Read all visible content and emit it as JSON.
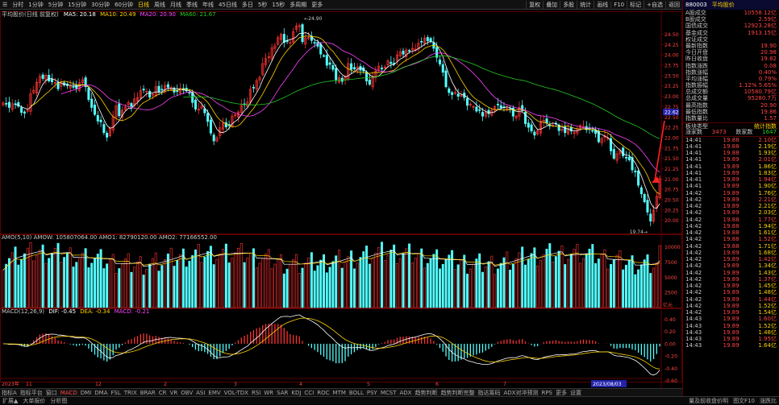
{
  "toolbar": {
    "items": [
      "分时",
      "1分钟",
      "5分钟",
      "15分钟",
      "30分钟",
      "60分钟",
      "日线",
      "周线",
      "月线",
      "季线",
      "年线",
      "45日线",
      "多日",
      "5秒",
      "15秒",
      "多周期",
      "更多"
    ],
    "right": [
      "复权",
      "叠加",
      "多股",
      "统计",
      "画线",
      "F10",
      "标记",
      "+自选",
      "返回"
    ]
  },
  "main_caption": {
    "name": "平均股价(日线 前复权)",
    "ma5": "MA5: 20.18",
    "ma10": "MA10: 20.49",
    "ma20": "MA20: 20.90",
    "ma60": "MA60: 21.67"
  },
  "price_axis": [
    "24.50",
    "24.25",
    "24.00",
    "23.75",
    "23.50",
    "23.25",
    "23.00",
    "22.75",
    "22.50",
    "22.25",
    "22.00",
    "21.75",
    "21.50",
    "21.25",
    "21.00",
    "20.75",
    "20.50",
    "20.25",
    "20.00"
  ],
  "current_price_tag": "22.62",
  "high_label": "24.90",
  "low_label": "19.74",
  "amo_caption": "AMO(5,10)  AMOW: 105807064.00  AMO1: 82790120.00  AMO2: 77166552.00",
  "amo_axis": [
    "10000",
    "7500",
    "5000",
    "2500"
  ],
  "amo_unit": "亿元",
  "macd_caption": {
    "name": "MACD(12,26,9)",
    "dif": "DIF: -0.45",
    "dea": "DEA: -0.34",
    "macd": "MACD: -0.21"
  },
  "macd_axis": [
    "0.40",
    "0.20",
    "0.00",
    "-0.20",
    "-0.40",
    "-0.60"
  ],
  "date_axis": {
    "start": "2023年",
    "labels": [
      "11",
      "12",
      "2",
      "3",
      "4",
      "5",
      "6",
      "7"
    ],
    "cursor_date": "2023/08/03"
  },
  "right_panel": {
    "code": "880003",
    "name": "平均股价",
    "stats": [
      {
        "k": "A股成交",
        "v": "10558.12亿"
      },
      {
        "k": "B股成交",
        "v": "2.59亿"
      },
      {
        "k": "国债成交",
        "v": "12923.28亿"
      },
      {
        "k": "基金成交",
        "v": "1913.15亿"
      },
      {
        "k": "权证成交",
        "v": ""
      },
      {
        "k": "最新指数",
        "v": "19.90"
      },
      {
        "k": "今日开盘",
        "v": "20.98"
      },
      {
        "k": "昨日收盘",
        "v": "19.82"
      },
      {
        "k": "指数涨跌",
        "v": "0.08"
      },
      {
        "k": "指数涨幅",
        "v": "0.40%"
      },
      {
        "k": "平均涨幅",
        "v": "0.79%"
      },
      {
        "k": "指数振幅",
        "v": "1.12% 5.65%"
      },
      {
        "k": "总成交额",
        "v": "10580.79亿"
      },
      {
        "k": "总成交量",
        "v": "95280.7万"
      },
      {
        "k": "最高指数",
        "v": "20.90"
      },
      {
        "k": "最低指数",
        "v": "19.86"
      },
      {
        "k": "指数量比",
        "v": "1.57"
      }
    ],
    "type_label": "板块类型",
    "type_value": "统计指数",
    "updown_label": "涨家数",
    "up_count": "3473",
    "down_label": "跌家数",
    "down_count": "1647",
    "ticks": [
      {
        "t": "14:41",
        "p": "19.88",
        "c": "2.10亿"
      },
      {
        "t": "14:41",
        "p": "19.88",
        "c": "2.19亿"
      },
      {
        "t": "14:41",
        "p": "19.88",
        "c": "1.93亿"
      },
      {
        "t": "14:41",
        "p": "19.89",
        "c": "2.01亿"
      },
      {
        "t": "14:41",
        "p": "19.89",
        "c": "1.86亿"
      },
      {
        "t": "14:41",
        "p": "19.89",
        "c": "1.83亿"
      },
      {
        "t": "14:41",
        "p": "19.89",
        "c": "1.94亿"
      },
      {
        "t": "14:41",
        "p": "19.89",
        "c": "1.90亿"
      },
      {
        "t": "14:42",
        "p": "19.89",
        "c": "1.76亿"
      },
      {
        "t": "14:42",
        "p": "19.89",
        "c": "2.21亿"
      },
      {
        "t": "14:42",
        "p": "19.89",
        "c": "2.21亿"
      },
      {
        "t": "14:42",
        "p": "19.89",
        "c": "2.03亿"
      },
      {
        "t": "14:42",
        "p": "19.88",
        "c": "1.77亿"
      },
      {
        "t": "14:42",
        "p": "19.88",
        "c": "1.94亿"
      },
      {
        "t": "14:42",
        "p": "19.88",
        "c": "1.61亿"
      },
      {
        "t": "14:42",
        "p": "19.88",
        "c": "1.52亿"
      },
      {
        "t": "14:42",
        "p": "19.88",
        "c": "1.71亿"
      },
      {
        "t": "14:42",
        "p": "19.89",
        "c": "1.68亿"
      },
      {
        "t": "14:42",
        "p": "19.89",
        "c": "1.42亿"
      },
      {
        "t": "14:42",
        "p": "19.89",
        "c": "1.34亿"
      },
      {
        "t": "14:42",
        "p": "19.89",
        "c": "1.43亿"
      },
      {
        "t": "14:42",
        "p": "19.89",
        "c": "1.37亿"
      },
      {
        "t": "14:42",
        "p": "19.89",
        "c": "1.45亿"
      },
      {
        "t": "14:42",
        "p": "19.89",
        "c": "1.48亿"
      },
      {
        "t": "14:42",
        "p": "19.89",
        "c": "1.44亿"
      },
      {
        "t": "14:42",
        "p": "19.89",
        "c": "1.52亿"
      },
      {
        "t": "14:42",
        "p": "19.89",
        "c": "1.54亿"
      },
      {
        "t": "14:43",
        "p": "19.89",
        "c": "1.60亿"
      },
      {
        "t": "14:43",
        "p": "19.89",
        "c": "1.52亿"
      },
      {
        "t": "14:43",
        "p": "19.89",
        "c": "1.48亿"
      },
      {
        "t": "14:43",
        "p": "19.89",
        "c": "1.95亿"
      },
      {
        "t": "14:43",
        "p": "19.89",
        "c": "1.64亿"
      }
    ]
  },
  "bottom_tabs": [
    "指标A",
    "指标平台",
    "窗口",
    "MACD",
    "DMI",
    "DMA",
    "FSL",
    "TRIX",
    "BRAR",
    "CR",
    "VR",
    "OBV",
    "ASI",
    "EMV",
    "VOL-TDX",
    "RSI",
    "WR",
    "SAR",
    "KDJ",
    "CCI",
    "ROC",
    "MTM",
    "BOLL",
    "PSY",
    "MCST",
    "ADX",
    "趋势判断",
    "趋势判断完整",
    "指达筹码",
    "ADX对冲预测",
    "RPS",
    "更多",
    "设置"
  ],
  "status_items": [
    "扩展▲",
    "大单报价",
    "分析图"
  ],
  "status_right": "量及前收盘价明 | 板块F10 | 涨跌比 | ≡",
  "status_right_items": [
    "量及前收盘价明",
    "图文F10",
    "涨跌比"
  ],
  "colors": {
    "up": "#ff3333",
    "down": "#54ffff",
    "ma5": "#ffffff",
    "ma10": "#ffd200",
    "ma20": "#ff44ff",
    "ma60": "#22cc22"
  },
  "chart_data": {
    "type": "candlestick",
    "ylim": [
      19.74,
      24.9
    ],
    "closes": [
      22.84,
      22.82,
      22.73,
      22.82,
      22.8,
      22.76,
      22.61,
      22.59,
      22.66,
      23.06,
      23.14,
      23.34,
      23.48,
      23.43,
      23.51,
      23.37,
      23.35,
      23.33,
      23.18,
      23.35,
      23.27,
      23.26,
      23.25,
      23.23,
      23.19,
      23.33,
      23.4,
      23.23,
      22.92,
      22.73,
      22.56,
      22.4,
      22.38,
      22.12,
      22.01,
      22.23,
      22.5,
      22.77,
      22.53,
      22.66,
      22.74,
      22.85,
      22.75,
      22.94,
      22.97,
      23.14,
      23.15,
      23.12,
      22.98,
      23.05,
      23.23,
      23.11,
      23.15,
      23.26,
      23.22,
      23.21,
      23.1,
      23.13,
      23.19,
      23.15,
      23.13,
      23.09,
      22.85,
      22.69,
      22.69,
      22.76,
      22.6,
      22.39,
      22.11,
      21.92,
      22.0,
      22.24,
      22.35,
      22.26,
      22.29,
      22.52,
      22.55,
      22.62,
      22.78,
      22.8,
      22.86,
      23.17,
      23.21,
      23.38,
      23.46,
      23.79,
      23.91,
      23.96,
      24.17,
      24.22,
      24.42,
      24.5,
      24.3,
      24.32,
      24.3,
      24.56,
      24.7,
      24.71,
      24.32,
      24.41,
      24.42,
      24.35,
      24.3,
      24.21,
      24.02,
      23.98,
      23.75,
      23.77,
      23.65,
      23.4,
      23.45,
      23.36,
      23.48,
      23.79,
      23.65,
      23.66,
      23.71,
      23.63,
      23.61,
      23.37,
      23.29,
      23.47,
      23.61,
      23.73,
      23.68,
      23.71,
      23.86,
      23.79,
      23.79,
      24.0,
      24.07,
      24.02,
      24.12,
      24.09,
      24.16,
      24.14,
      24.28,
      24.31,
      24.41,
      24.34,
      24.32,
      24.16,
      23.94,
      23.78,
      23.58,
      23.23,
      23.09,
      23.04,
      23.09,
      23.0,
      23.02,
      22.97,
      22.78,
      22.81,
      22.75,
      22.64,
      22.66,
      22.52,
      22.61,
      22.58,
      22.66,
      22.75,
      22.8,
      22.72,
      22.73,
      22.71,
      22.68,
      22.52,
      22.52,
      22.73,
      22.65,
      22.34,
      22.25,
      22.16,
      22.06,
      22.17,
      22.39,
      22.42,
      22.35,
      22.3,
      22.3,
      22.34,
      22.17,
      22.2,
      22.12,
      22.22,
      22.16,
      22.12,
      22.21,
      22.29,
      22.27,
      22.19,
      22.21,
      22.17,
      22.1,
      21.9,
      21.98,
      22.04,
      21.99,
      21.68,
      21.5,
      21.61,
      21.7,
      21.56,
      21.52,
      21.46,
      21.22,
      21.17,
      20.85,
      20.64,
      20.45,
      20.2,
      19.98,
      20.25,
      20.58,
      21.01
    ]
  }
}
